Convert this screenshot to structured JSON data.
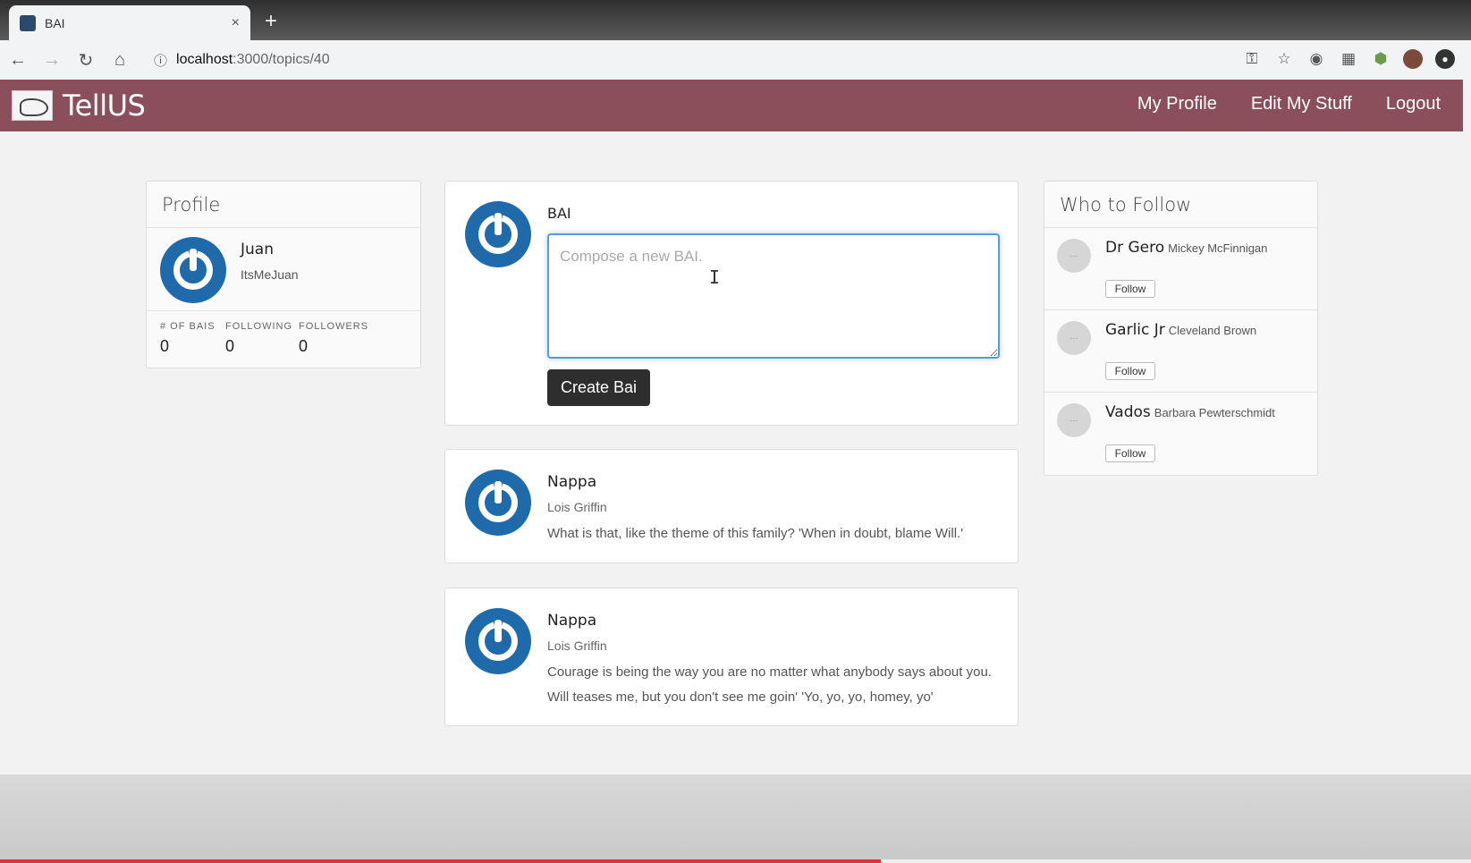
{
  "browser": {
    "tab_title": "BAI",
    "tab_close": "×",
    "new_tab": "+",
    "url_host": "localhost",
    "url_path": ":3000/topics/40"
  },
  "app": {
    "brand": "TellUS",
    "nav": [
      "My Profile",
      "Edit My Stuff",
      "Logout"
    ],
    "accent_color": "#8b4f5c"
  },
  "profile": {
    "heading": "Profile",
    "name": "Juan",
    "handle": "ItsMeJuan",
    "stats": [
      {
        "label": "# OF BAIS",
        "value": "0"
      },
      {
        "label": "FOLLOWING",
        "value": "0"
      },
      {
        "label": "FOLLOWERS",
        "value": "0"
      }
    ]
  },
  "compose": {
    "label": "BAI",
    "placeholder": "Compose a new BAI.",
    "button": "Create Bai"
  },
  "posts": [
    {
      "author": "Nappa",
      "handle": "Lois Griffin",
      "body": "What is that, like the theme of this family? 'When in doubt, blame Will.'"
    },
    {
      "author": "Nappa",
      "handle": "Lois Griffin",
      "body": "Courage is being the way you are no matter what anybody says about you. Will teases me, but you don't see me goin' 'Yo, yo, yo, homey, yo'"
    }
  ],
  "who_to_follow": {
    "heading": "Who to Follow",
    "button": "Follow",
    "people": [
      {
        "name": "Dr Gero",
        "sub": "Mickey McFinnigan"
      },
      {
        "name": "Garlic Jr",
        "sub": "Cleveland Brown"
      },
      {
        "name": "Vados",
        "sub": "Barbara Pewterschmidt"
      }
    ]
  }
}
